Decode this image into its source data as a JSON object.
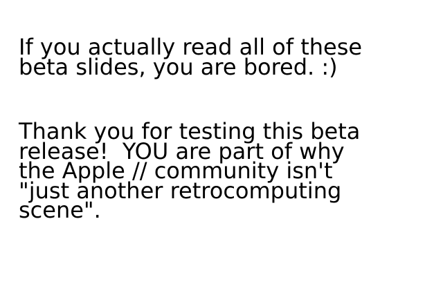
{
  "slide": {
    "paragraphs": [
      "If you actually read all of these\nbeta slides, you are bored. :)",
      "Thank you for testing this beta\nrelease!  YOU are part of why\nthe Apple // community isn't\n\"just another retrocomputing\nscene\"."
    ]
  },
  "colors": {
    "background": "#ffffff",
    "text": "#000000"
  }
}
